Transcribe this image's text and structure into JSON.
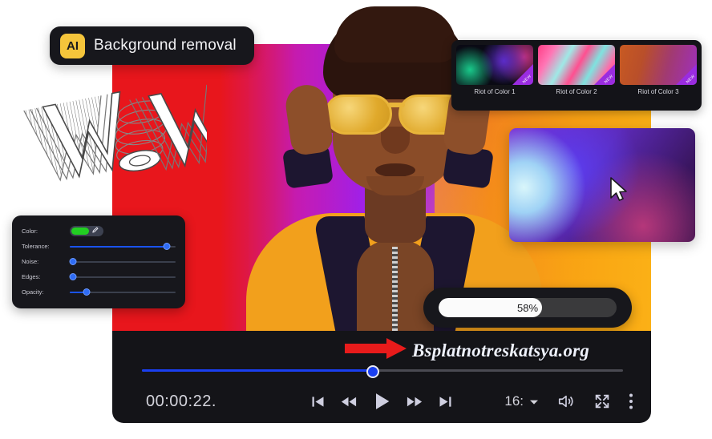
{
  "ai_badge": {
    "chip": "AI",
    "label": "Background removal",
    "chip_color": "#f5c53b"
  },
  "decor": {
    "wow_text": "WOW"
  },
  "thumbnails": {
    "items": [
      {
        "caption": "Riot of Color 1",
        "badge": "NEW"
      },
      {
        "caption": "Riot of Color 2",
        "badge": "NEW"
      },
      {
        "caption": "Riot of Color 3",
        "badge": "NEW"
      }
    ]
  },
  "preview_card": {
    "cursor": "mouse-pointer"
  },
  "settings_panel": {
    "rows": [
      {
        "label": "Color:",
        "type": "color",
        "value": "#22cf22",
        "pipette": "eyedropper"
      },
      {
        "label": "Tolerance:",
        "type": "slider",
        "value": 92
      },
      {
        "label": "Noise:",
        "type": "slider",
        "value": 3
      },
      {
        "label": "Edges:",
        "type": "slider",
        "value": 3
      },
      {
        "label": "Opacity:",
        "type": "slider",
        "value": 16
      }
    ]
  },
  "progress": {
    "percent_label": "58%",
    "percent": 58
  },
  "watermark": {
    "text": "Bsplatnotreskatsya.org",
    "arrow": "red-arrow-right"
  },
  "player": {
    "time": "00:00:22.",
    "seek_percent": 48,
    "transport": [
      {
        "name": "skip-previous",
        "glyph": "skip-back-icon"
      },
      {
        "name": "rewind",
        "glyph": "rewind-icon"
      },
      {
        "name": "play",
        "glyph": "play-icon"
      },
      {
        "name": "fast-forward",
        "glyph": "fast-forward-icon"
      },
      {
        "name": "skip-next",
        "glyph": "skip-forward-icon"
      }
    ],
    "ratio_label": "16:",
    "right_controls": [
      {
        "name": "volume",
        "glyph": "volume-icon"
      },
      {
        "name": "fullscreen",
        "glyph": "fullscreen-icon"
      },
      {
        "name": "more",
        "glyph": "more-vertical-icon"
      }
    ]
  },
  "colors": {
    "accent_blue": "#1a3ff0",
    "panel_dark": "#17171c",
    "badge_yellow": "#f5c53b"
  }
}
